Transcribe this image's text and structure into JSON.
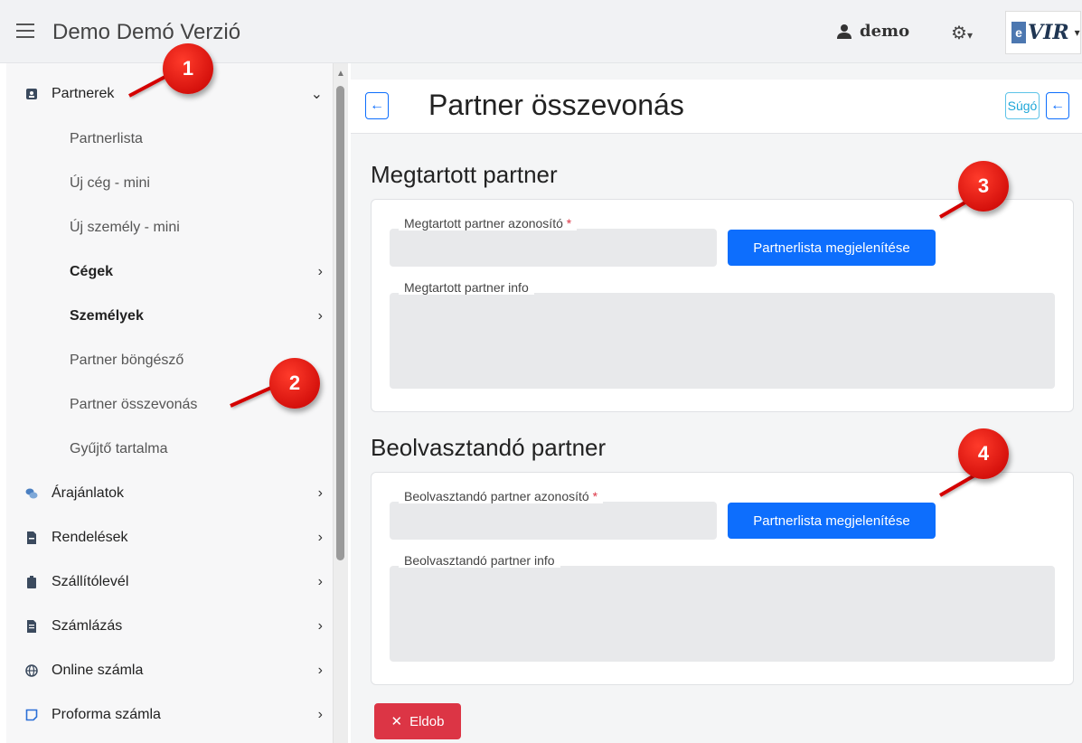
{
  "app": {
    "title": "Demo Demó Verzió",
    "user": "demo",
    "logo_text": "VIR",
    "logo_e": "e"
  },
  "sidebar": {
    "items": [
      {
        "label": "Partnerek",
        "icon": "contact-card-icon",
        "chevron": "⌄"
      },
      {
        "label": "Partnerlista"
      },
      {
        "label": "Új cég - mini"
      },
      {
        "label": "Új személy - mini"
      },
      {
        "label": "Cégek",
        "chevron": "›"
      },
      {
        "label": "Személyek",
        "chevron": "›"
      },
      {
        "label": "Partner böngésző"
      },
      {
        "label": "Partner összevonás"
      },
      {
        "label": "Gyűjtő tartalma"
      },
      {
        "label": "Árajánlatok",
        "icon": "chat-bubbles-icon",
        "chevron": "›"
      },
      {
        "label": "Rendelések",
        "icon": "document-icon",
        "chevron": "›"
      },
      {
        "label": "Szállítólevél",
        "icon": "clipboard-icon",
        "chevron": "›"
      },
      {
        "label": "Számlázás",
        "icon": "invoice-icon",
        "chevron": "›"
      },
      {
        "label": "Online számla",
        "icon": "globe-icon",
        "chevron": "›"
      },
      {
        "label": "Proforma számla",
        "icon": "note-icon",
        "chevron": "›"
      }
    ]
  },
  "page": {
    "title": "Partner összevonás",
    "help_label": "Súgó",
    "section1": {
      "title": "Megtartott partner",
      "id_label": "Megtartott partner azonosító",
      "button": "Partnerlista megjelenítése",
      "info_label": "Megtartott partner info"
    },
    "section2": {
      "title": "Beolvasztandó partner",
      "id_label": "Beolvasztandó partner azonosító",
      "button": "Partnerlista megjelenítése",
      "info_label": "Beolvasztandó partner info"
    },
    "discard_label": "Eldob",
    "required_mark": "*"
  },
  "badges": [
    "1",
    "2",
    "3",
    "4"
  ],
  "colors": {
    "primary": "#0d6efd",
    "danger": "#dc3545",
    "help": "#1fa7d8",
    "badge": "#d40000"
  }
}
